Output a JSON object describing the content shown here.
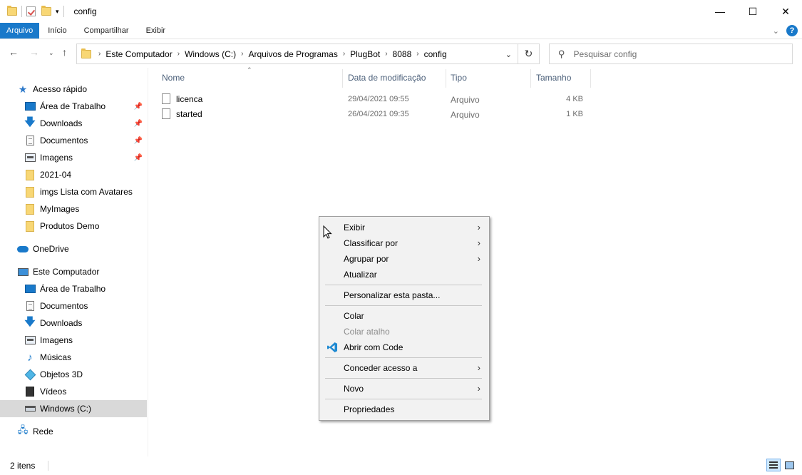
{
  "window": {
    "title": "config",
    "controls": {
      "minimize": "—",
      "maximize": "☐",
      "close": "✕"
    }
  },
  "ribbon": {
    "tabs": [
      "Arquivo",
      "Início",
      "Compartilhar",
      "Exibir"
    ],
    "help": "?"
  },
  "address": {
    "crumbs": [
      "Este Computador",
      "Windows (C:)",
      "Arquivos de Programas",
      "PlugBot",
      "8088",
      "config"
    ]
  },
  "search": {
    "placeholder": "Pesquisar config"
  },
  "sidebar": {
    "quick_access": "Acesso rápido",
    "quick_items": [
      "Área de Trabalho",
      "Downloads",
      "Documentos",
      "Imagens",
      "2021-04",
      "imgs Lista com Avatares",
      "MyImages",
      "Produtos Demo"
    ],
    "onedrive": "OneDrive",
    "this_pc": "Este Computador",
    "pc_items": [
      "Área de Trabalho",
      "Documentos",
      "Downloads",
      "Imagens",
      "Músicas",
      "Objetos 3D",
      "Vídeos",
      "Windows (C:)"
    ],
    "network": "Rede"
  },
  "columns": {
    "name": "Nome",
    "modified": "Data de modificação",
    "type": "Tipo",
    "size": "Tamanho"
  },
  "files": [
    {
      "name": "licenca",
      "modified": "29/04/2021 09:55",
      "type": "Arquivo",
      "size": "4 KB"
    },
    {
      "name": "started",
      "modified": "26/04/2021 09:35",
      "type": "Arquivo",
      "size": "1 KB"
    }
  ],
  "context_menu": {
    "exibir": "Exibir",
    "classificar": "Classificar por",
    "agrupar": "Agrupar por",
    "atualizar": "Atualizar",
    "personalizar": "Personalizar esta pasta...",
    "colar": "Colar",
    "colar_atalho": "Colar atalho",
    "abrir_code": "Abrir com Code",
    "conceder": "Conceder acesso a",
    "novo": "Novo",
    "propriedades": "Propriedades"
  },
  "status": {
    "items": "2 itens"
  }
}
